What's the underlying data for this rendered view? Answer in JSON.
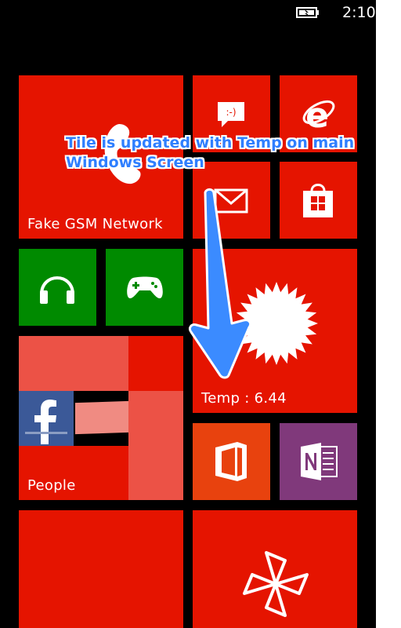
{
  "status_bar": {
    "time": "2:10",
    "battery_icon": "battery-charging-icon"
  },
  "tiles": {
    "phone": {
      "label": "Fake GSM Network",
      "icon": "phone-handset-icon"
    },
    "messaging": {
      "icon_text": ":-)",
      "icon": "messaging-icon"
    },
    "ie": {
      "icon": "internet-explorer-icon"
    },
    "mail": {
      "icon": "mail-icon"
    },
    "store": {
      "icon": "store-icon"
    },
    "music": {
      "icon": "headphones-icon"
    },
    "games": {
      "icon": "xbox-controller-icon"
    },
    "weather_app": {
      "label": "Temp : 6.44",
      "icon": "sunburst-icon"
    },
    "people": {
      "label": "People",
      "icon": "facebook-icon"
    },
    "office": {
      "icon": "office-icon"
    },
    "onenote": {
      "icon": "onenote-icon"
    }
  },
  "annotation": {
    "line1": "Tile is updated with Temp on main",
    "line2": "Windows Screen"
  },
  "colors": {
    "tile_red": "#e51400",
    "tile_green": "#008a00",
    "tile_orange": "#e8420e",
    "tile_purple": "#80397b",
    "annotation_blue": "#2f7fff"
  }
}
